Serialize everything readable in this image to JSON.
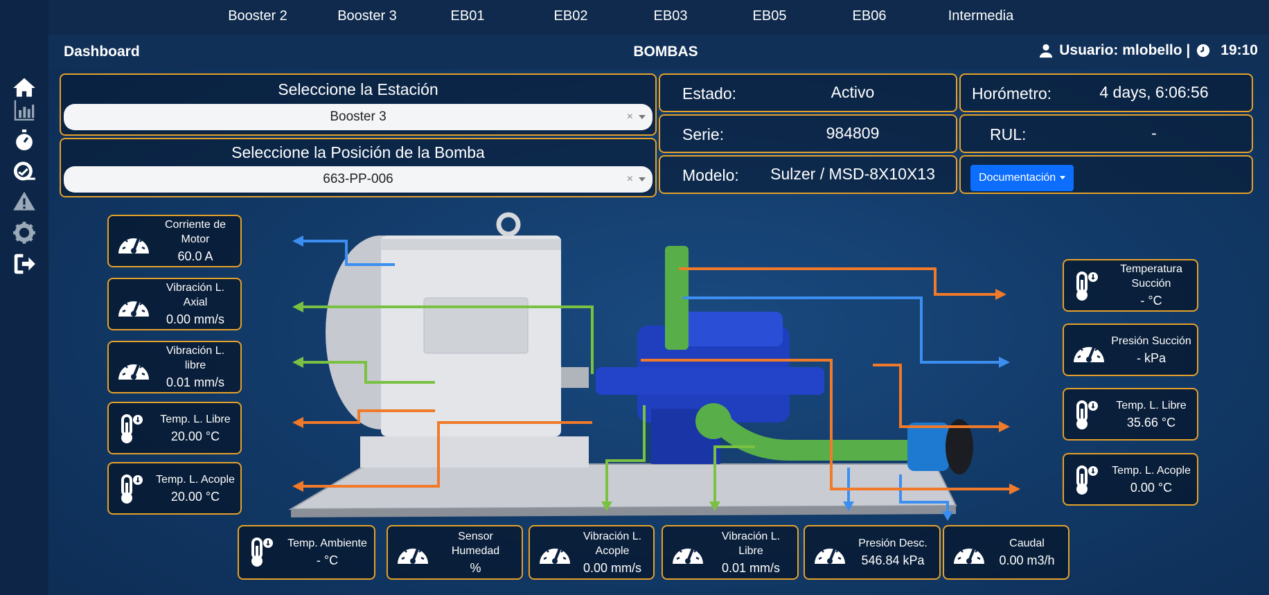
{
  "nav": {
    "tabs": [
      "Booster 2",
      "Booster 3",
      "EB01",
      "EB02",
      "EB03",
      "EB05",
      "EB06",
      "Intermedia"
    ]
  },
  "header": {
    "title": "Dashboard",
    "center": "BOMBAS",
    "user": "Usuario: mlobello |",
    "time": "19:10"
  },
  "sidebar": {
    "icons": [
      "home-icon",
      "chart-icon",
      "stopwatch-icon",
      "gauge-search-icon",
      "warning-icon",
      "gear-icon",
      "logout-icon"
    ]
  },
  "station": {
    "label": "Seleccione la Estación",
    "value": "Booster 3",
    "clear": "×"
  },
  "pump": {
    "label": "Seleccione la Posición de la Bomba",
    "value": "663-PP-006",
    "clear": "×"
  },
  "info": {
    "estado_label": "Estado:",
    "estado_value": "Activo",
    "serie_label": "Serie:",
    "serie_value": "984809",
    "modelo_label": "Modelo:",
    "modelo_value": "Sulzer / MSD-8X10X13",
    "horometro_label": "Horómetro:",
    "horometro_value": "4 days, 6:06:56",
    "rul_label": "RUL:",
    "rul_value": "-",
    "doc_button": "Documentación"
  },
  "left_cards": [
    {
      "label": "Corriente de Motor",
      "value": "60.0 A",
      "icon": "gauge-icon"
    },
    {
      "label": "Vibración L. Axial",
      "value": "0.00 mm/s",
      "icon": "gauge-icon"
    },
    {
      "label": "Vibración L. libre",
      "value": "0.01 mm/s",
      "icon": "gauge-icon"
    },
    {
      "label": "Temp. L. Libre",
      "value": "20.00 °C",
      "icon": "thermometer-icon"
    },
    {
      "label": "Temp. L. Acople",
      "value": "20.00 °C",
      "icon": "thermometer-icon"
    }
  ],
  "right_cards": [
    {
      "label": "Temperatura Succión",
      "value": "- °C",
      "icon": "thermometer-icon"
    },
    {
      "label": "Presión Succión",
      "value": "- kPa",
      "icon": "gauge-icon"
    },
    {
      "label": "Temp. L. Libre",
      "value": "35.66 °C",
      "icon": "thermometer-icon"
    },
    {
      "label": "Temp. L. Acople",
      "value": "0.00 °C",
      "icon": "thermometer-icon"
    }
  ],
  "bottom_cards": [
    {
      "label": "Temp. Ambiente",
      "value": "- °C",
      "icon": "thermometer-icon"
    },
    {
      "label": "Sensor Humedad",
      "value": "%",
      "icon": "gauge-icon"
    },
    {
      "label": "Vibración L. Acople",
      "value": "0.00 mm/s",
      "icon": "gauge-icon"
    },
    {
      "label": "Vibración L. Libre",
      "value": "0.01 mm/s",
      "icon": "gauge-icon"
    },
    {
      "label": "Presión Desc.",
      "value": "546.84 kPa",
      "icon": "gauge-icon"
    },
    {
      "label": "Caudal",
      "value": "0.00 m3/h",
      "icon": "gauge-icon"
    }
  ],
  "colors": {
    "accent_border": "#e6a12a",
    "arrow_blue": "#3c8ef0",
    "arrow_green": "#7ac143",
    "arrow_orange": "#f07a2a",
    "button_blue": "#0d6efd"
  }
}
